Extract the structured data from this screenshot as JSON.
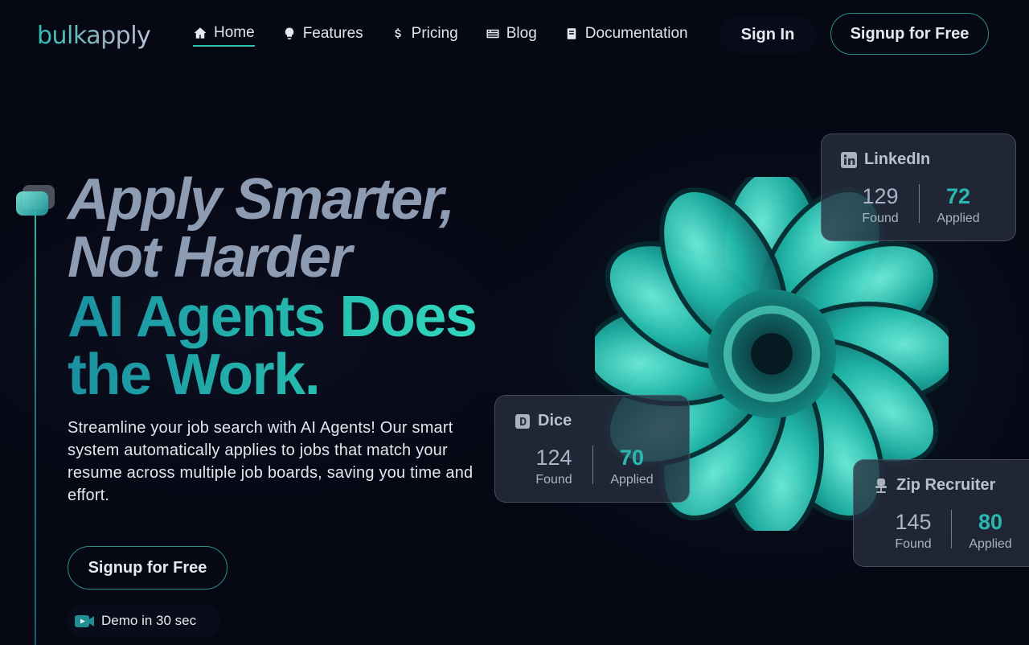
{
  "brand": {
    "name": "bulkapply"
  },
  "nav": {
    "items": [
      {
        "label": "Home",
        "icon": "home-icon",
        "active": true
      },
      {
        "label": "Features",
        "icon": "lightbulb-icon",
        "active": false
      },
      {
        "label": "Pricing",
        "icon": "dollar-icon",
        "active": false
      },
      {
        "label": "Blog",
        "icon": "newspaper-icon",
        "active": false
      },
      {
        "label": "Documentation",
        "icon": "book-icon",
        "active": false
      }
    ],
    "sign_in": "Sign In",
    "signup": "Signup for Free"
  },
  "hero": {
    "headline_line1": "Apply Smarter,",
    "headline_line2": "Not Harder",
    "subheadline_line1": "AI Agents Does",
    "subheadline_line2": "the Work.",
    "description": "Streamline your job search with AI Agents! Our smart system automatically applies to jobs that match your resume across multiple job boards, saving you time and effort.",
    "cta": "Signup for Free",
    "demo": "Demo in 30 sec"
  },
  "cards": {
    "linkedin": {
      "title": "LinkedIn",
      "found": "129",
      "found_label": "Found",
      "applied": "72",
      "applied_label": "Applied"
    },
    "dice": {
      "title": "Dice",
      "found": "124",
      "found_label": "Found",
      "applied": "70",
      "applied_label": "Applied"
    },
    "ziprecruiter": {
      "title": "Zip Recruiter",
      "found": "145",
      "found_label": "Found",
      "applied": "80",
      "applied_label": "Applied"
    }
  },
  "colors": {
    "accent": "#2cc2b3",
    "background": "#060814",
    "headline": "#8d9bb3"
  }
}
